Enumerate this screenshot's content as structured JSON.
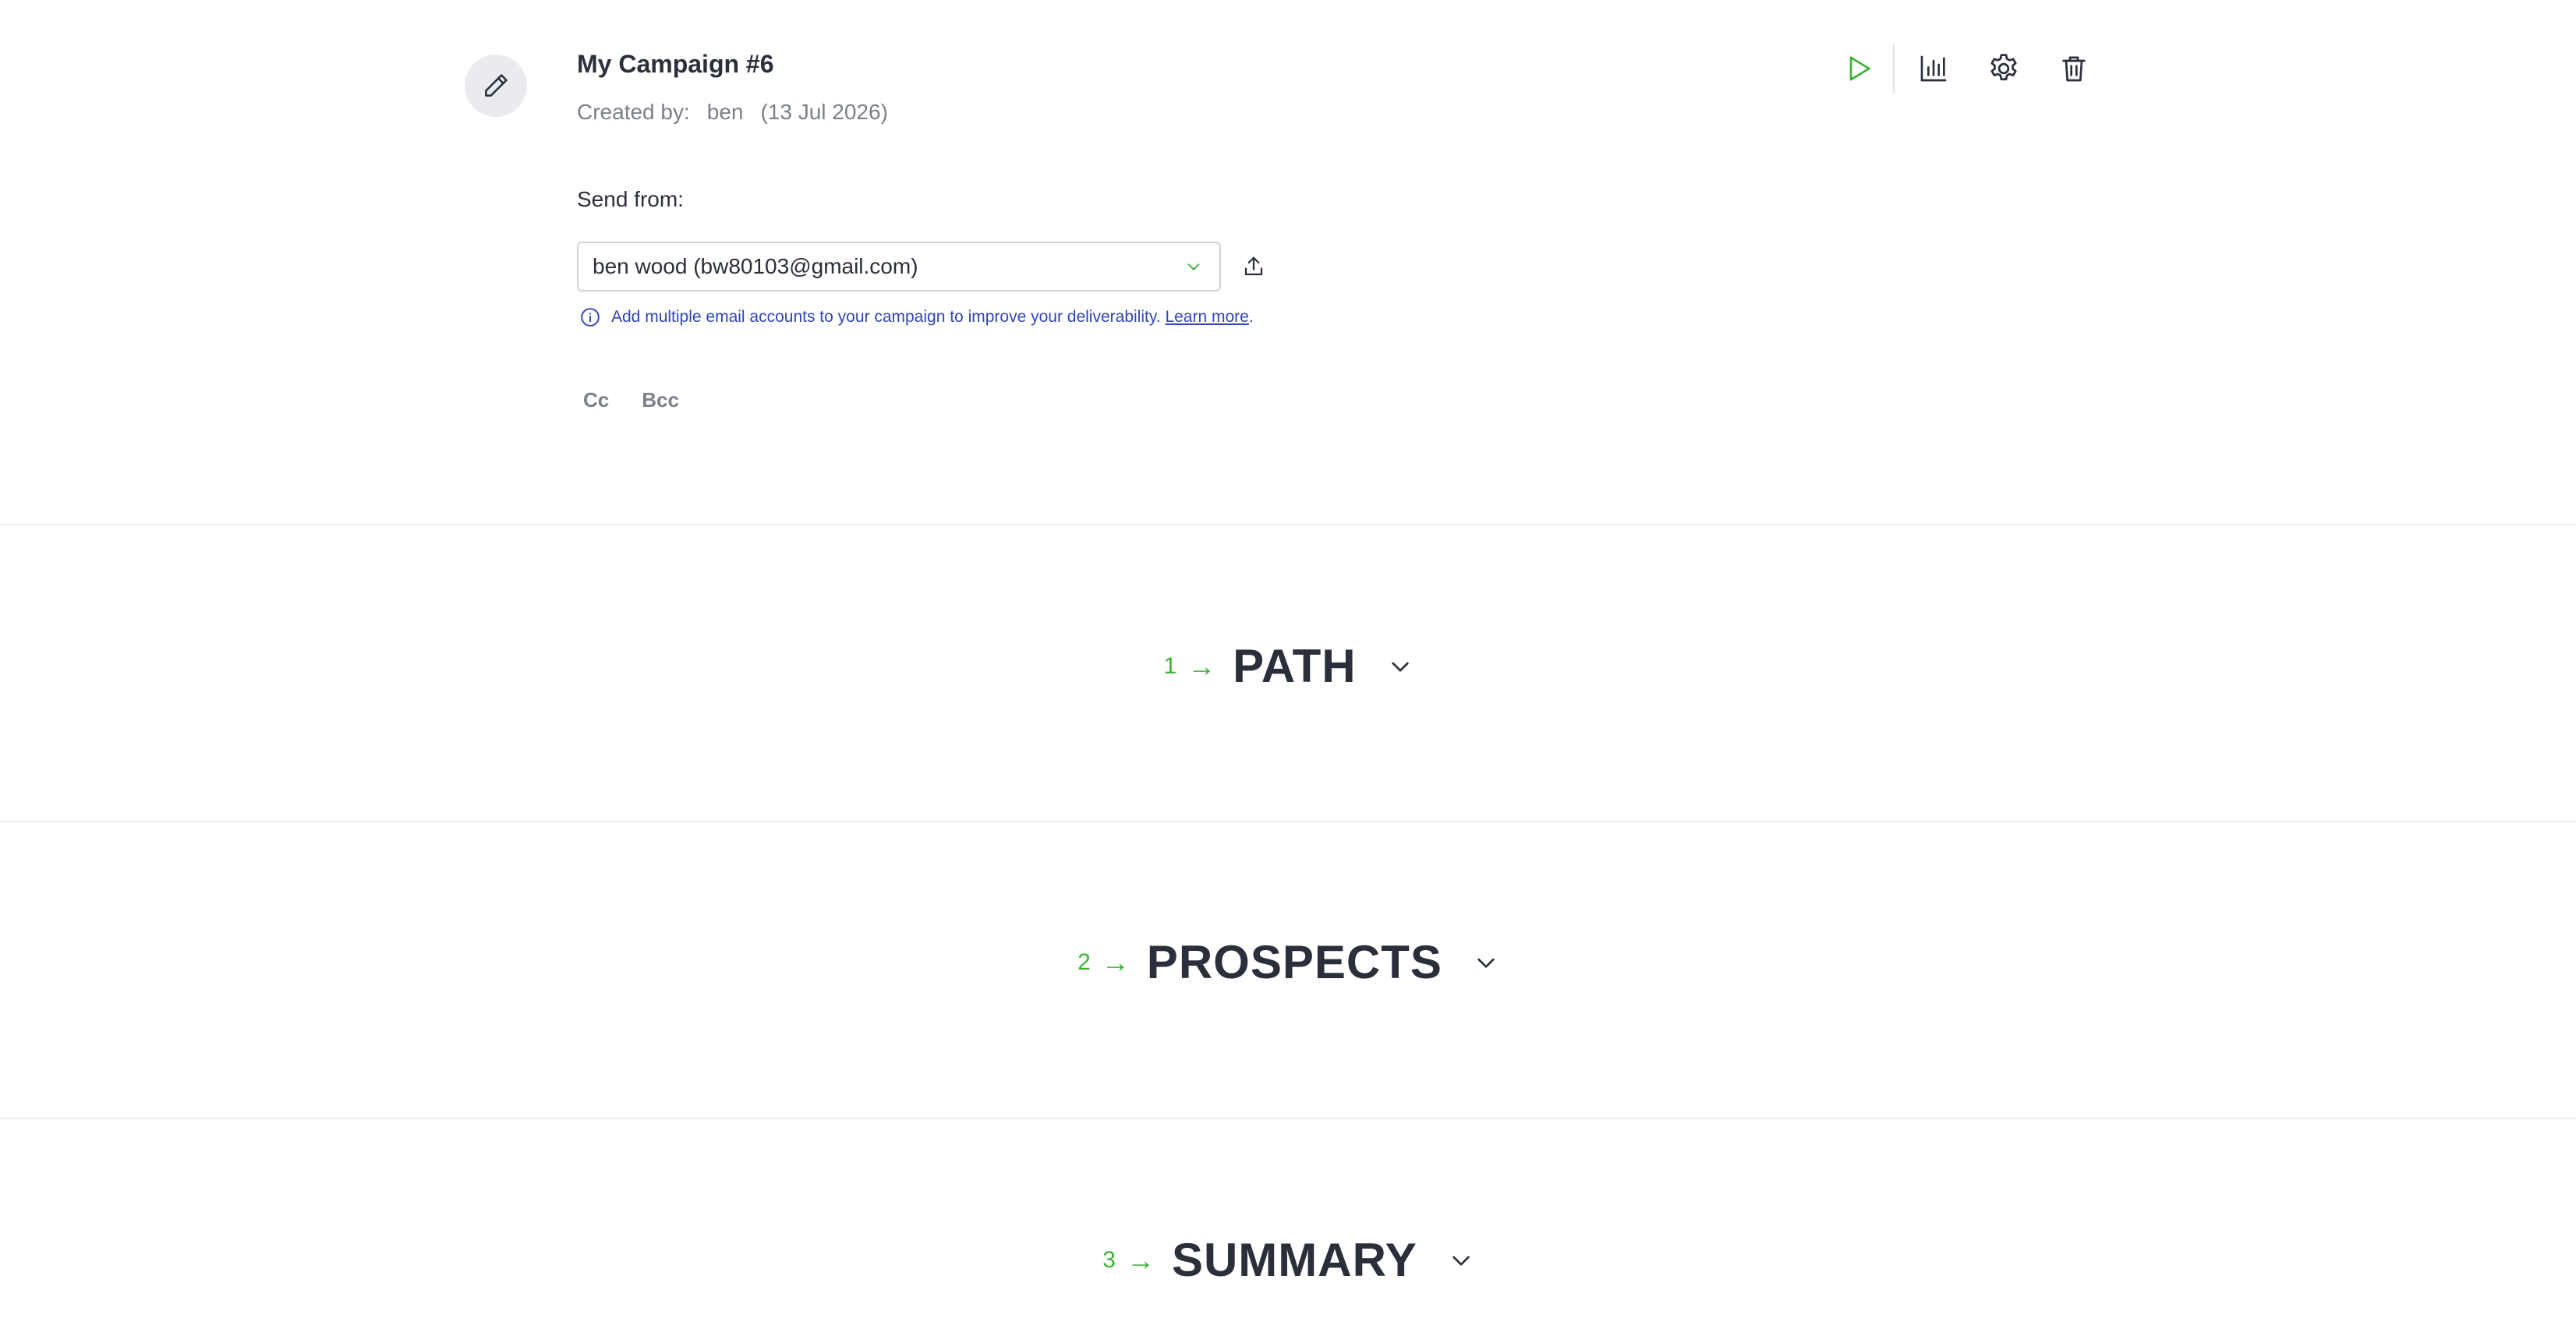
{
  "header": {
    "title": "My Campaign #6",
    "created_by_label": "Created by:",
    "author": "ben",
    "created_date": "(13 Jul 2026)",
    "edit_icon": "pencil-icon",
    "toolbar": [
      {
        "icon": "play-icon",
        "color": "#3cb234"
      },
      {
        "icon": "bar-chart-icon",
        "color": "#2b2f3b"
      },
      {
        "icon": "gear-icon",
        "color": "#2b2f3b"
      },
      {
        "icon": "trash-icon",
        "color": "#2b2f3b"
      }
    ]
  },
  "send_from": {
    "label": "Send from:",
    "selected_account": "ben wood (bw80103@gmail.com)",
    "info_text": "Add multiple email accounts to your campaign to improve your deliverability.",
    "learn_more": "Learn more",
    "info_trailing": ".",
    "cc_label": "Cc",
    "bcc_label": "Bcc"
  },
  "sections": [
    {
      "number": "1",
      "arrow": "→",
      "title": "PATH"
    },
    {
      "number": "2",
      "arrow": "→",
      "title": "PROSPECTS"
    },
    {
      "number": "3",
      "arrow": "→",
      "title": "SUMMARY"
    }
  ],
  "colors": {
    "accent_green": "#3cb234",
    "link_blue": "#3046b8",
    "text_dark": "#2b2f3b",
    "text_muted": "#7b7f8c"
  }
}
